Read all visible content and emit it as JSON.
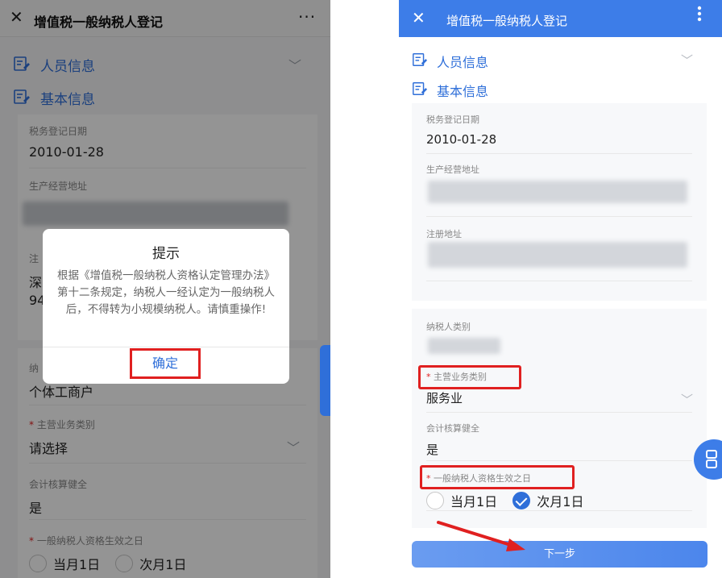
{
  "left_screen": {
    "header": {
      "close_glyph": "✕",
      "title": "增值税一般纳税人登记",
      "more_glyph": "···"
    },
    "sections": [
      {
        "label": "人员信息",
        "icon": "form-icon"
      },
      {
        "label": "基本信息",
        "icon": "form-icon"
      }
    ],
    "fields": {
      "reg_date_caption": "税务登记日期",
      "reg_date_value": "2010-01-28",
      "address_caption": "生产经营地址",
      "reg_addr_caption_partial": "注",
      "reg_addr_value_partial_1": "深",
      "reg_addr_value_partial_2": "94",
      "taxpayer_type_caption_partial": "纳",
      "taxpayer_type_value": "个体工商户",
      "main_biz_caption": "主营业务类别",
      "main_biz_value": "请选择",
      "accounting_caption": "会计核算健全",
      "accounting_value": "是",
      "effective_date_caption": "一般纳税人资格生效之日",
      "radio_current_month": "当月1日",
      "radio_next_month": "次月1日"
    },
    "required_mark": "*",
    "dialog": {
      "title": "提示",
      "message": "根据《增值税一般纳税人资格认定管理办法》第十二条规定，纳税人一经认定为一般纳税人后，不得转为小规模纳税人。请慎重操作!",
      "confirm_label": "确定"
    }
  },
  "right_screen": {
    "header": {
      "close_glyph": "✕",
      "title": "增值税一般纳税人登记",
      "more_glyph": "⋮"
    },
    "sections": [
      {
        "label": "人员信息",
        "icon": "form-icon"
      },
      {
        "label": "基本信息",
        "icon": "form-icon"
      }
    ],
    "fields": {
      "reg_date_caption": "税务登记日期",
      "reg_date_value": "2010-01-28",
      "address_caption": "生产经营地址",
      "reg_addr_caption": "注册地址",
      "taxpayer_type_caption": "纳税人类别",
      "main_biz_caption": "主营业务类别",
      "main_biz_value": "服务业",
      "accounting_caption": "会计核算健全",
      "accounting_value": "是",
      "effective_date_caption": "一般纳税人资格生效之日",
      "radio_current_month": "当月1日",
      "radio_next_month": "次月1日",
      "selected_radio": "次月1日"
    },
    "required_mark": "*",
    "next_button": "下一步"
  },
  "colors": {
    "accent_blue": "#3d7de8",
    "link_blue": "#2f6fd9",
    "highlight_red": "#e02020"
  }
}
